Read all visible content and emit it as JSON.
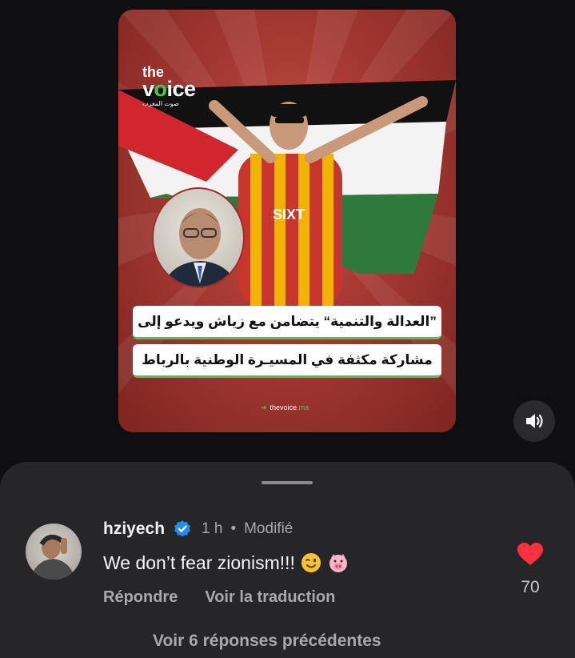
{
  "post": {
    "brand_the": "the",
    "brand_voice": "voice",
    "brand_sub": "صوت المغرب",
    "headline_line1": "”العدالة والتنمية“ يتضامن مع زياش ويدعو إلى",
    "headline_line2": "مشاركة مكثفة في المسيـرة الوطنية بالرباط",
    "site_tag": "thevoice",
    "site_tld": ".ma",
    "jersey_sponsor": "SIXT",
    "colors": {
      "accent_green": "#3ccf4e",
      "bg_red": "#a83a33"
    }
  },
  "sound_button": {
    "icon": "speaker-icon"
  },
  "comment": {
    "username": "hziyech",
    "verified_icon": "verified-badge-icon",
    "time": "1 h",
    "edited": "Modifié",
    "text": "We don’t fear zionism!!!",
    "emojis": [
      "winking-face-emoji",
      "pig-face-emoji"
    ],
    "reply_label": "Répondre",
    "translate_label": "Voir la traduction",
    "like_count": "70",
    "like_icon": "heart-icon",
    "like_color": "#ff3040"
  },
  "replies": {
    "label": "Voir 6 réponses précédentes"
  }
}
